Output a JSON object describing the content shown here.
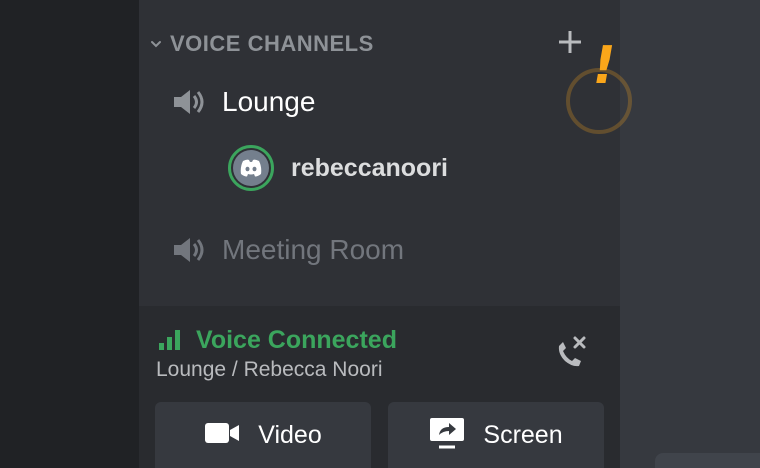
{
  "category": {
    "label": "VOICE CHANNELS"
  },
  "channels": [
    {
      "name": "Lounge",
      "active": true
    },
    {
      "name": "Meeting Room",
      "active": false
    }
  ],
  "voice_users": [
    {
      "username": "rebeccanoori"
    }
  ],
  "voice_panel": {
    "status": "Voice Connected",
    "location": "Lounge / Rebecca Noori",
    "video_label": "Video",
    "screen_label": "Screen"
  },
  "colors": {
    "connected_green": "#3ba55d",
    "alert_orange": "#faa61a",
    "sidebar_bg": "#2f3136",
    "panel_bg": "#292b2f"
  },
  "icons": {
    "chevron": "chevron-down-icon",
    "add": "plus-icon",
    "speaker": "speaker-icon",
    "avatar": "discord-logo-icon",
    "signal": "signal-bars-icon",
    "disconnect": "phone-disconnect-icon",
    "video": "camera-icon",
    "screen": "screen-share-icon"
  }
}
